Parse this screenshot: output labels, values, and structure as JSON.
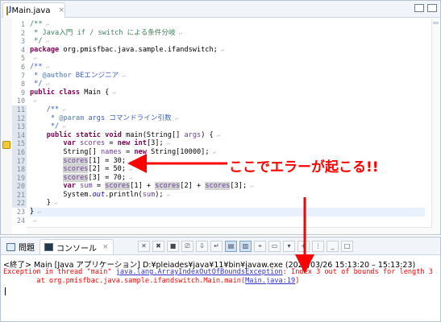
{
  "editor": {
    "tab_label": "Main.java",
    "tab_close": "×",
    "line_numbers": [
      "1",
      "2",
      "3",
      "4",
      "5",
      "6",
      "7",
      "8",
      "9",
      "10",
      "11",
      "12",
      "13",
      "14",
      "15",
      "16",
      "17",
      "18",
      "19",
      "20",
      "21",
      "22",
      "23",
      "24"
    ],
    "lines": [
      [
        [
          "c",
          "/**"
        ]
      ],
      [
        [
          "c",
          " * Java入門 if / switch による条件分岐"
        ]
      ],
      [
        [
          "c",
          " */"
        ]
      ],
      [
        [
          "kw",
          "package"
        ],
        [
          "t",
          " org.pmisfbac.java.sample.ifandswitch;"
        ]
      ],
      [
        [
          "t",
          ""
        ]
      ],
      [
        [
          "jd",
          "/**"
        ]
      ],
      [
        [
          "jd",
          " * "
        ],
        [
          "tagc",
          "@author"
        ],
        [
          "jd",
          " BEエンジニア"
        ]
      ],
      [
        [
          "jd",
          " */"
        ]
      ],
      [
        [
          "kw",
          "public"
        ],
        [
          "t",
          " "
        ],
        [
          "kw",
          "class"
        ],
        [
          "t",
          " Main {"
        ]
      ],
      [
        [
          "t",
          ""
        ]
      ],
      [
        [
          "t",
          "    "
        ],
        [
          "jd",
          "/**"
        ]
      ],
      [
        [
          "jd",
          "     * "
        ],
        [
          "tagc",
          "@param"
        ],
        [
          "jd",
          " args コマンドライン引数"
        ]
      ],
      [
        [
          "jd",
          "     */"
        ]
      ],
      [
        [
          "t",
          "    "
        ],
        [
          "kw",
          "public"
        ],
        [
          "t",
          " "
        ],
        [
          "kw",
          "static"
        ],
        [
          "t",
          " "
        ],
        [
          "kw",
          "void"
        ],
        [
          "t",
          " main(String[] "
        ],
        [
          "var",
          "args"
        ],
        [
          "t",
          ") {"
        ]
      ],
      [
        [
          "t",
          "        "
        ],
        [
          "kw",
          "var"
        ],
        [
          "t",
          " "
        ],
        [
          "var",
          "scores"
        ],
        [
          "t",
          " = "
        ],
        [
          "kw",
          "new"
        ],
        [
          "t",
          " "
        ],
        [
          "kw",
          "int"
        ],
        [
          "t",
          "[3];"
        ]
      ],
      [
        [
          "t",
          "        String[] "
        ],
        [
          "var",
          "names"
        ],
        [
          "t",
          " = "
        ],
        [
          "kw",
          "new"
        ],
        [
          "t",
          " String[10000];"
        ]
      ],
      [
        [
          "t",
          "        "
        ],
        [
          "hl",
          "scores"
        ],
        [
          "t",
          "[1] = 30;"
        ]
      ],
      [
        [
          "t",
          "        "
        ],
        [
          "hl",
          "scores"
        ],
        [
          "t",
          "[2] = 50;"
        ]
      ],
      [
        [
          "t",
          "        "
        ],
        [
          "hl",
          "scores"
        ],
        [
          "t",
          "[3] = 70;"
        ]
      ],
      [
        [
          "t",
          "        "
        ],
        [
          "kw",
          "var"
        ],
        [
          "t",
          " "
        ],
        [
          "var",
          "sum"
        ],
        [
          "t",
          " = "
        ],
        [
          "hl",
          "scores"
        ],
        [
          "t",
          "[1] + "
        ],
        [
          "hl",
          "scores"
        ],
        [
          "t",
          "[2] + "
        ],
        [
          "hl",
          "scores"
        ],
        [
          "t",
          "[3];"
        ]
      ],
      [
        [
          "t",
          "        System."
        ],
        [
          "fld",
          "out"
        ],
        [
          "t",
          ".println("
        ],
        [
          "var",
          "sum"
        ],
        [
          "t",
          ");"
        ]
      ],
      [
        [
          "t",
          "    }"
        ]
      ],
      [
        [
          "t",
          "}"
        ]
      ],
      [
        [
          "t",
          ""
        ]
      ]
    ]
  },
  "callout": "ここでエラーが起こる!!",
  "console": {
    "tab_problems": "問題",
    "tab_console": "コンソール",
    "tab_console_close": "×",
    "header": "<終了> Main [Java アプリケーション] D:¥pleiades¥java¥11¥bin¥javaw.exe (2020/03/26 15:13:20 – 15:13:23)",
    "err_line1": "Exception in thread \"main\" ",
    "err_link1": "java.lang.ArrayIndexOutOfBoundsException",
    "err_line1_tail": ": Index 3 out of bounds for length 3",
    "err_line2": "\tat org.pmisfbac.java.sample.ifandswitch.Main.main(",
    "err_link2": "Main.java:19",
    "err_line2_tail": ")"
  },
  "colors": {
    "keyword": "#7f0055",
    "comment": "#3f7f5f",
    "javadoc": "#3f5fbf",
    "error_text": "#ff0000",
    "annotation": "#ff0000",
    "link": "#3333cc"
  },
  "icons": [
    "java-file-icon",
    "problems-icon",
    "console-icon",
    "warning-marker-icon"
  ]
}
